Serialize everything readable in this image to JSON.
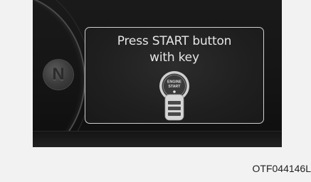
{
  "display": {
    "message_line1": "Press START button",
    "message_line2": "with key",
    "gear_indicator": "N",
    "button_icon": {
      "name": "engine-start-button-icon",
      "label_line1": "ENGINE",
      "label_line2": "START"
    },
    "key_icon": "smart-key-icon"
  },
  "figure_code": "OTF044146L",
  "colors": {
    "background": "#f2f2f2",
    "cluster": "#161616",
    "panel_border": "#cfcfcf",
    "text": "#e6e6e6"
  }
}
